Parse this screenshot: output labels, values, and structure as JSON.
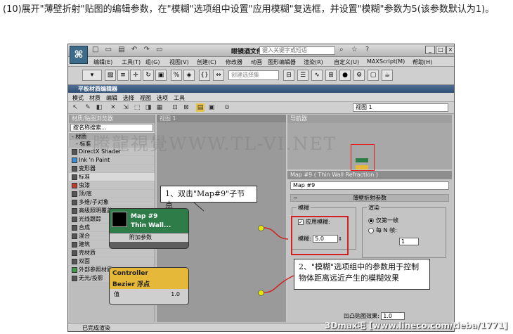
{
  "instruction": "(10)展开\"薄壁折射\"贴图的编辑参数，在\"模糊\"选项组中设置\"应用模糊\"复选框，并设置\"模糊\"参数为5(该参数默认为1)。",
  "max": {
    "filename": "眼镜酒文件.max",
    "search_placeholder": "键入关键字或短语",
    "menu": [
      "编辑(E)",
      "工具(T)",
      "组(G)",
      "视图(V)",
      "创建(C)",
      "修改器",
      "动画",
      "图形编辑器",
      "渲染(R)",
      "自定义(U)",
      "MAXScript(M)",
      "帮助(H)"
    ],
    "selection_set_placeholder": "创建选择集"
  },
  "slate": {
    "title": "平板材质编辑器",
    "menu": [
      "模式",
      "材质",
      "编辑",
      "选择",
      "视图",
      "选项",
      "工具"
    ],
    "view_select": "视图 1",
    "status": "已完成渲染"
  },
  "browser": {
    "header": "材质/贴图浏览器",
    "search_placeholder": "按名称搜索...",
    "group": "- 材质",
    "subgroup": "- 标准",
    "items": [
      {
        "label": "DirectX Shader",
        "color": "#555555"
      },
      {
        "label": "Ink 'n Paint",
        "color": "#3b8fd6"
      },
      {
        "label": "变形器",
        "color": "#555555"
      },
      {
        "label": "标准",
        "color": "#555555"
      },
      {
        "label": "虫漆",
        "color": "#c23a2a"
      },
      {
        "label": "顶/底",
        "color": "#555555"
      },
      {
        "label": "多维/子对象",
        "color": "#555555"
      },
      {
        "label": "高级照明覆盖",
        "color": "#555555"
      },
      {
        "label": "光线跟踪",
        "color": "#555555"
      },
      {
        "label": "合成",
        "color": "#555555"
      },
      {
        "label": "混合",
        "color": "#555555"
      },
      {
        "label": "建筑",
        "color": "#555555"
      },
      {
        "label": "壳材质",
        "color": "#555555"
      },
      {
        "label": "双面",
        "color": "#555555"
      },
      {
        "label": "外部参照材质",
        "color": "#3e9a4c"
      },
      {
        "label": "无光/投影",
        "color": "#555555"
      }
    ]
  },
  "canvas": {
    "tab": "视图 1",
    "watermark": "腾龍視覺WWW.TL-VI.NET",
    "map_node": {
      "title1": "Map #9",
      "title2": "Thin Wall...",
      "add": "附加参数"
    },
    "ctrl_node": {
      "title1": "Controller",
      "title2": "Bezier 浮点",
      "row_label": "值",
      "row_value": "1.0"
    }
  },
  "navigator": {
    "header": "导航器"
  },
  "params": {
    "header": "Map #9 ( Thin Wall Refraction )",
    "name": "Map #9",
    "rollout": "薄壁折射参数",
    "blur_group": "模糊",
    "apply_blur": "应用模糊:",
    "blur_label": "模糊:",
    "blur_value": "5.0",
    "render_group": "渲染",
    "first_frame": "仅第一帧",
    "every_n": "每 N 帧:",
    "n_value": "1",
    "bump_label": "凹凸贴图效果:",
    "bump_value": "1.0"
  },
  "callouts": {
    "one": "1、双击\"Map#9\"子节点",
    "two": "2、\"模糊\"选项组中的参数用于控制物体距离远近产生的模糊效果"
  },
  "site_watermark": "3Dmax吧 [www.lineco.com/tieba/1771]"
}
